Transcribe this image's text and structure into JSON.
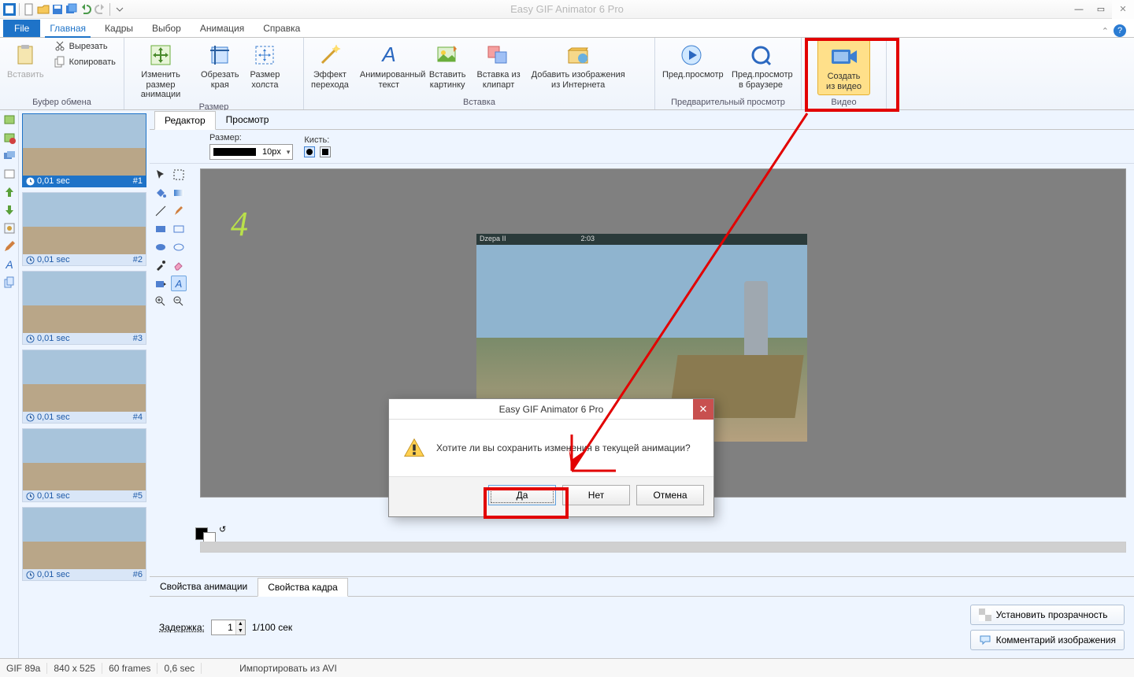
{
  "app_title": "Easy GIF Animator 6 Pro",
  "qat": {
    "new": "new",
    "open": "open",
    "save": "save",
    "saveall": "saveall",
    "undo": "undo",
    "redo": "redo"
  },
  "tabs": {
    "file": "File",
    "items": [
      "Главная",
      "Кадры",
      "Выбор",
      "Анимация",
      "Справка"
    ],
    "active": 0
  },
  "ribbon": {
    "clipboard": {
      "paste": "Вставить",
      "cut": "Вырезать",
      "copy": "Копировать",
      "group": "Буфер обмена"
    },
    "size": {
      "resize_anim": "Изменить размер\nанимации",
      "crop": "Обрезать\nкрая",
      "canvas": "Размер\nхолста",
      "group": "Размер"
    },
    "insert": {
      "transition": "Эффект\nперехода",
      "atext": "Анимированный\nтекст",
      "picture": "Вставить\nкартинку",
      "clipart": "Вставка из\nклипарт",
      "web": "Добавить изображения\nиз Интернета",
      "group": "Вставка"
    },
    "preview": {
      "preview": "Пред.просмотр",
      "browser": "Пред.просмотр\nв браузере",
      "group": "Предварительный просмотр"
    },
    "video": {
      "create": "Создать\nиз видео",
      "group": "Видео"
    }
  },
  "frames": [
    {
      "time": "0,01 sec",
      "num": "#1",
      "sel": true
    },
    {
      "time": "0,01 sec",
      "num": "#2",
      "sel": false
    },
    {
      "time": "0,01 sec",
      "num": "#3",
      "sel": false
    },
    {
      "time": "0,01 sec",
      "num": "#4",
      "sel": false
    },
    {
      "time": "0,01 sec",
      "num": "#5",
      "sel": false
    },
    {
      "time": "0,01 sec",
      "num": "#6",
      "sel": false
    }
  ],
  "wa_tabs": {
    "items": [
      "Редактор",
      "Просмотр"
    ],
    "active": 0
  },
  "toolbar": {
    "size_label": "Размер:",
    "size_val": "10px",
    "brush_label": "Кисть:"
  },
  "four": "4",
  "props": {
    "tabs": [
      "Свойства анимации",
      "Свойства кадра"
    ],
    "active": 1,
    "delay_label": "Задержка:",
    "delay_val": "1",
    "delay_unit": "1/100 сек",
    "set_transparency": "Установить прозрачность",
    "comment": "Комментарий изображения"
  },
  "status": {
    "gif": "GIF 89a",
    "dim": "840 x 525",
    "frames": "60 frames",
    "dur": "0,6 sec",
    "action": "Импортировать из AVI"
  },
  "dialog": {
    "title": "Easy GIF Animator 6 Pro",
    "text": "Хотите ли вы сохранить изменения в текущей анимации?",
    "yes": "Да",
    "no": "Нет",
    "cancel": "Отмена"
  }
}
